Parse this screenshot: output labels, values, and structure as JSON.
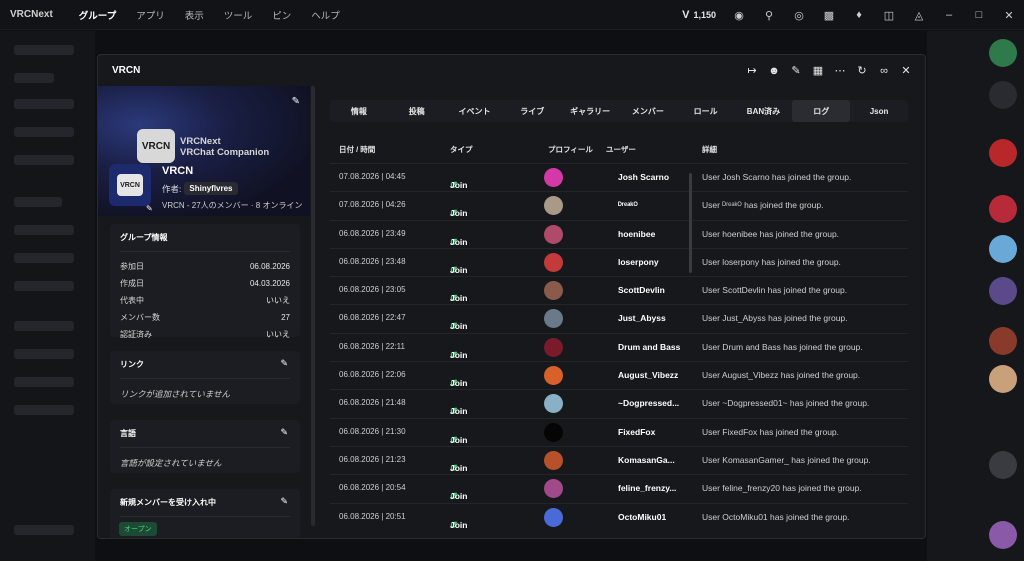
{
  "app": {
    "name": "VRCNext",
    "menu": [
      "グループ",
      "アプリ",
      "表示",
      "ツール",
      "ピン",
      "ヘルプ"
    ],
    "active_menu": "グループ",
    "v_count": "1,150"
  },
  "dialog": {
    "title": "VRCN",
    "group_name": "VRCN",
    "banner_line1": "VRCNext",
    "banner_line2": "VRChat Companion",
    "logo_text": "VRCN",
    "avatar_text": "VRCN",
    "author_label": "作者:",
    "author_name": "Shinyflvres",
    "members_line": "VRCN - 27人のメンバー · 8 オンライン",
    "info_card": {
      "title": "グループ情報",
      "rows": [
        {
          "k": "参加日",
          "v": "06.08.2026"
        },
        {
          "k": "作成日",
          "v": "04.03.2026"
        },
        {
          "k": "代表中",
          "v": "いいえ"
        },
        {
          "k": "メンバー数",
          "v": "27"
        },
        {
          "k": "認証済み",
          "v": "いいえ"
        }
      ]
    },
    "links_card": {
      "title": "リンク",
      "note": "リンクが追加されていません"
    },
    "lang_card": {
      "title": "言語",
      "note": "言語が設定されていません"
    },
    "accept_card": {
      "title": "新規メンバーを受け入れ中",
      "badge": "オープン"
    },
    "tabs": [
      "情報",
      "投稿",
      "イベント",
      "ライブ",
      "ギャラリー",
      "メンバー",
      "ロール",
      "BAN済み",
      "ログ",
      "Json"
    ],
    "active_tab": "ログ",
    "table": {
      "headers": {
        "date": "日付 / 時間",
        "type": "タイプ",
        "profile": "プロフィール",
        "user": "ユーザー",
        "detail": "詳細"
      },
      "rows": [
        {
          "date": "07.08.2026 | 04:45",
          "type": "Join",
          "avatar_color": "#d33aa8",
          "user": "Josh Scarno",
          "detail": "User Josh Scarno has joined the group."
        },
        {
          "date": "07.08.2026 | 04:26",
          "type": "Join",
          "avatar_color": "#a89a86",
          "user": "ᴰʳᵉᵃᵏᴼ",
          "detail": "User ᴰʳᵉᵃᵏᴼ has joined the group."
        },
        {
          "date": "06.08.2026 | 23:49",
          "type": "Join",
          "avatar_color": "#b04a6a",
          "user": "hoenibee",
          "detail": "User hoenibee has joined the group."
        },
        {
          "date": "06.08.2026 | 23:48",
          "type": "Join",
          "avatar_color": "#c23a3a",
          "user": "loserpony",
          "detail": "User loserpony has joined the group."
        },
        {
          "date": "06.08.2026 | 23:05",
          "type": "Join",
          "avatar_color": "#8a5a4a",
          "user": "ScottDevlin",
          "detail": "User ScottDevlin has joined the group."
        },
        {
          "date": "06.08.2026 | 22:47",
          "type": "Join",
          "avatar_color": "#6a7a8a",
          "user": "Just_Abyss",
          "detail": "User Just_Abyss has joined the group."
        },
        {
          "date": "06.08.2026 | 22:11",
          "type": "Join",
          "avatar_color": "#7a1a2a",
          "user": "Drum and Bass",
          "detail": "User Drum and Bass has joined the group."
        },
        {
          "date": "06.08.2026 | 22:06",
          "type": "Join",
          "avatar_color": "#d8602a",
          "user": "August_Vibezz",
          "detail": "User August_Vibezz has joined the group."
        },
        {
          "date": "06.08.2026 | 21:48",
          "type": "Join",
          "avatar_color": "#8ab0c8",
          "user": "~Dogpressed...",
          "detail": "User ~Dogpressed01~ has joined the group."
        },
        {
          "date": "06.08.2026 | 21:30",
          "type": "Join",
          "avatar_color": "#050505",
          "user": "FixedFox",
          "detail": "User FixedFox has joined the group."
        },
        {
          "date": "06.08.2026 | 21:23",
          "type": "Join",
          "avatar_color": "#b8502a",
          "user": "KomasanGa...",
          "detail": "User KomasanGamer_ has joined the group."
        },
        {
          "date": "06.08.2026 | 20:54",
          "type": "Join",
          "avatar_color": "#a04a8a",
          "user": "feline_frenzy...",
          "detail": "User feline_frenzy20 has joined the group."
        },
        {
          "date": "06.08.2026 | 20:51",
          "type": "Join",
          "avatar_color": "#4a6ad8",
          "user": "OctoMiku01",
          "detail": "User OctoMiku01 has joined the group."
        }
      ]
    }
  }
}
